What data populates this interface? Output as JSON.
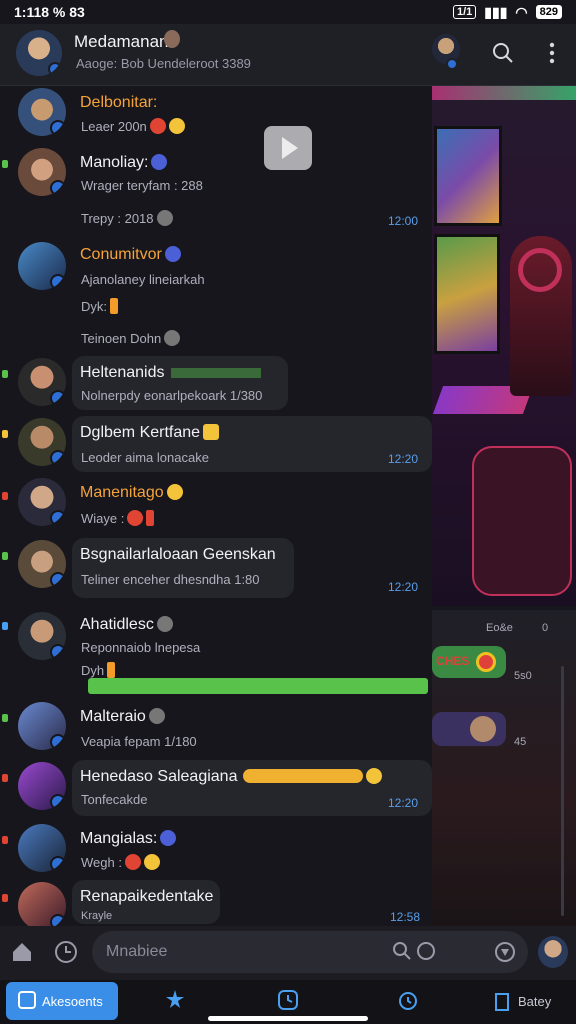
{
  "status": {
    "time": "1:118 % 83",
    "sim": "1/1",
    "battery": "829"
  },
  "header": {
    "title": "Medamanan",
    "subtitle": "Aaoge: Bob Uendeleroot 3389"
  },
  "chats": [
    {
      "name": "Delbonitar:",
      "line1": "Leaer 200n",
      "line2": "",
      "time": ""
    },
    {
      "name": "Manoliay:",
      "line1": "Wrager teryfam : 288",
      "line2": "Trepy : 2018",
      "time": "12:00"
    },
    {
      "name": "Conumitvor",
      "line1": "Ajanolaney lineiarkah",
      "line2": "Dyk:",
      "line3": "Teinoen Dohn",
      "time": ""
    },
    {
      "name": "Heltenanids",
      "line1": "Nolnerpdy eonarlpekoark 1/380",
      "time": ""
    },
    {
      "name": "Dglbem Kertfane",
      "line1": "Leoder aima lonacake",
      "time": "12:20"
    },
    {
      "name": "Manenitago",
      "line1": "Wiaye :",
      "time": ""
    },
    {
      "name": "Bsgnailarlaloaan Geenskan",
      "line1": "Teliner enceher dhesndha 1:80",
      "time": "12:20"
    },
    {
      "name": "Ahatidlesc",
      "line1": "Reponnaiob lnepesa",
      "line2": "Dyh",
      "time": ""
    },
    {
      "name": "Malteraio",
      "line1": "Veapia fepam 1/180",
      "time": ""
    },
    {
      "name": "Henedaso Saleagiana",
      "line1": "Tonfecakde",
      "time": "12:20"
    },
    {
      "name": "Mangialas:",
      "line1": "Wegh :",
      "time": ""
    },
    {
      "name": "Renapaikedentake",
      "line1": "Krayle",
      "time": "12:58"
    }
  ],
  "right_scene": {
    "lower_label_1": "Eo&e",
    "lower_label_2": "0",
    "lower_label_3": "5s0",
    "lower_label_4": "45",
    "pill_text": "CHES"
  },
  "input": {
    "placeholder": "Mnabiee"
  },
  "nav": {
    "active_label": "Akesoents",
    "last_label": "Batey"
  },
  "colors": {
    "accent": "#3a8ee8",
    "name_orange": "#f5a33a",
    "time_blue": "#5a9ee8",
    "progress_green": "#58c24a"
  }
}
